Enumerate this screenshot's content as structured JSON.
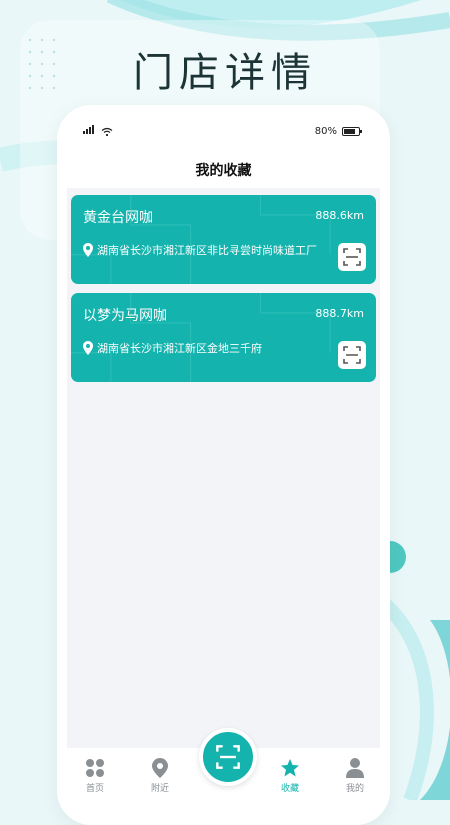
{
  "banner": {
    "title": "门店详情"
  },
  "status_bar": {
    "battery_label": "80%",
    "battery_level": 0.8
  },
  "page": {
    "title": "我的收藏"
  },
  "favorites": [
    {
      "name": "黄金台网咖",
      "distance": "888.6km",
      "address": "湖南省长沙市湘江新区非比寻尝时尚味道工厂"
    },
    {
      "name": "以梦为马网咖",
      "distance": "888.7km",
      "address": "湖南省长沙市湘江新区金地三千府"
    }
  ],
  "tabs": [
    {
      "label": "首页",
      "icon": "grid-icon"
    },
    {
      "label": "附近",
      "icon": "location-icon"
    },
    {
      "label": "收藏",
      "icon": "star-icon"
    },
    {
      "label": "我的",
      "icon": "user-icon"
    }
  ],
  "colors": {
    "accent": "#14b3ad",
    "background": "#e9f7f8"
  }
}
